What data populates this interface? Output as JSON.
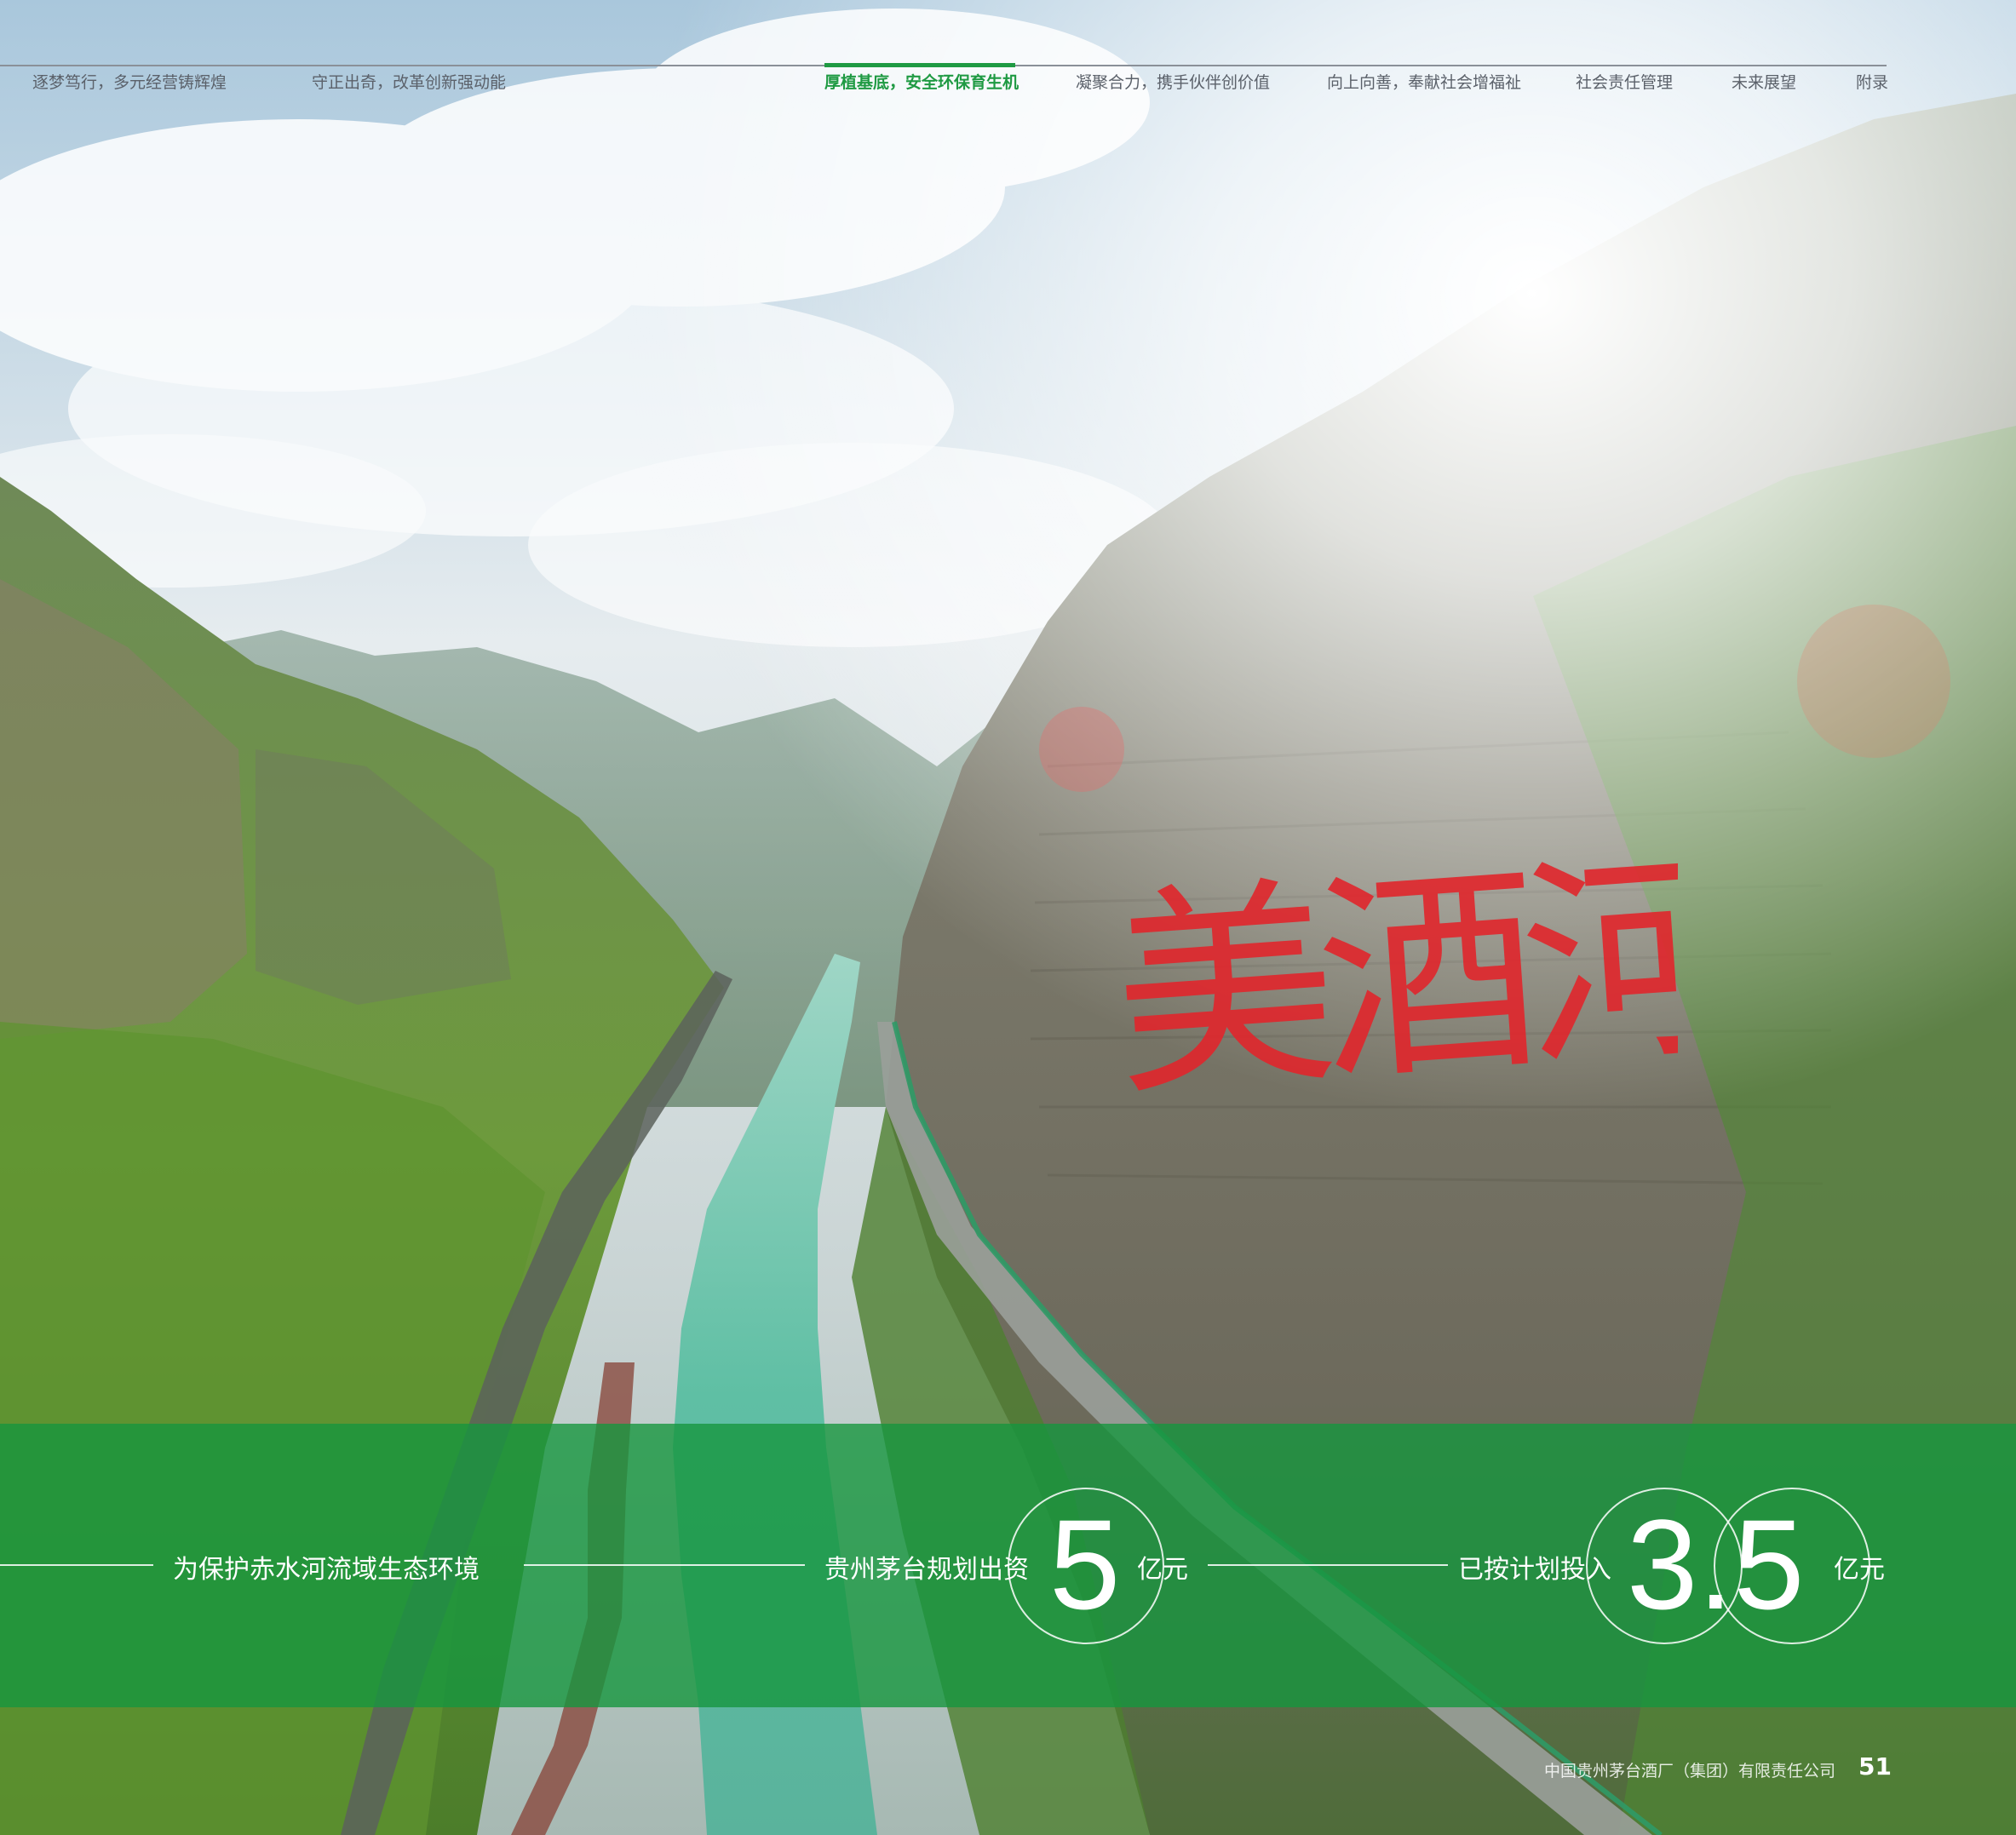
{
  "nav": {
    "items": [
      {
        "label": "逐梦笃行，多元经营铸辉煌",
        "active": false
      },
      {
        "label": "守正出奇，改革创新强动能",
        "active": false
      },
      {
        "label": "厚植基底，安全环保育生机",
        "active": true
      },
      {
        "label": "凝聚合力，携手伙伴创价值",
        "active": false
      },
      {
        "label": "向上向善，奉献社会增福祉",
        "active": false
      },
      {
        "label": "社会责任管理",
        "active": false
      },
      {
        "label": "未来展望",
        "active": false
      },
      {
        "label": "附录",
        "active": false
      }
    ],
    "active_color": "#1f9a43"
  },
  "cliff_text": "美酒河",
  "band": {
    "statement": "为保护赤水河流域生态环境",
    "planned_label": "贵州茅台规划出资",
    "planned_value": "5",
    "planned_unit": "亿元",
    "invested_label": "已按计划投入",
    "invested_value": "3.5",
    "invested_unit": "亿元",
    "color": "#16963e"
  },
  "footer": {
    "company": "中国贵州茅台酒厂（集团）有限责任公司",
    "page": "51"
  }
}
